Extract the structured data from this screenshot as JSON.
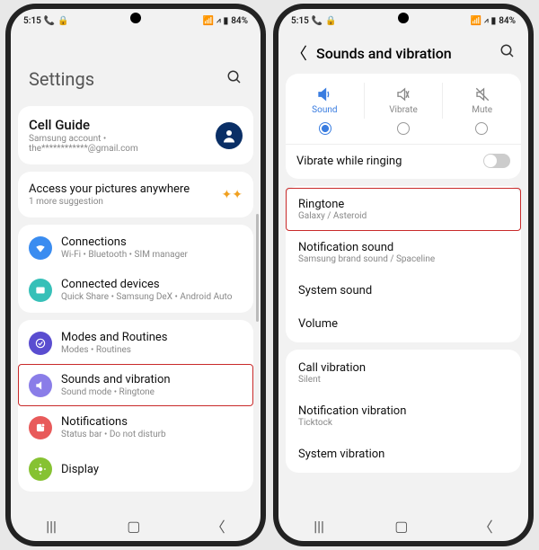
{
  "status": {
    "time": "5:15",
    "battery": "84%"
  },
  "p1": {
    "title": "Settings",
    "account": {
      "name": "Cell Guide",
      "sub": "Samsung account  •  the************@gmail.com"
    },
    "promo": {
      "title": "Access your pictures anywhere",
      "sub": "1 more suggestion"
    },
    "items": [
      {
        "icon_bg": "#3a8cf0",
        "title": "Connections",
        "sub": "Wi-Fi  •  Bluetooth  •  SIM manager"
      },
      {
        "icon_bg": "#36c0b8",
        "title": "Connected devices",
        "sub": "Quick Share  •  Samsung DeX  •  Android Auto"
      },
      {
        "icon_bg": "#5a4dd0",
        "title": "Modes and Routines",
        "sub": "Modes  •  Routines"
      },
      {
        "icon_bg": "#8a7de8",
        "title": "Sounds and vibration",
        "sub": "Sound mode  •  Ringtone",
        "hl": true
      },
      {
        "icon_bg": "#e85a5a",
        "title": "Notifications",
        "sub": "Status bar  •  Do not disturb"
      },
      {
        "icon_bg": "#86c232",
        "title": "Display",
        "sub": ""
      }
    ]
  },
  "p2": {
    "title": "Sounds and vibration",
    "modes": [
      {
        "label": "Sound",
        "active": true
      },
      {
        "label": "Vibrate",
        "active": false
      },
      {
        "label": "Mute",
        "active": false
      }
    ],
    "vibrate_ringing": "Vibrate while ringing",
    "group_a": [
      {
        "title": "Ringtone",
        "sub": "Galaxy / Asteroid",
        "hl": true
      },
      {
        "title": "Notification sound",
        "sub": "Samsung brand sound / Spaceline"
      },
      {
        "title": "System sound",
        "sub": ""
      },
      {
        "title": "Volume",
        "sub": ""
      }
    ],
    "group_b": [
      {
        "title": "Call vibration",
        "sub": "Silent"
      },
      {
        "title": "Notification vibration",
        "sub": "Ticktock"
      },
      {
        "title": "System vibration",
        "sub": ""
      }
    ]
  }
}
